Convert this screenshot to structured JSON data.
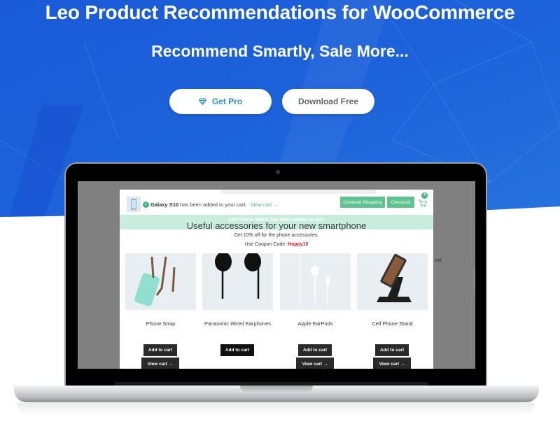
{
  "hero": {
    "title": "Leo Product Recommendations for WooCommerce",
    "subtitle": "Recommend Smartly, Sale More...",
    "buttons": {
      "get_pro": {
        "label": "Get Pro",
        "icon": "diamond-icon"
      },
      "download_free": {
        "label": "Download Free"
      }
    },
    "colors": {
      "background": "#1d63da",
      "pro_text": "#2c8fd8",
      "free_text": "#666666"
    }
  },
  "popup": {
    "notice": {
      "product": "Galaxy S10",
      "message": "has been added to your cart.",
      "view_cart": "View cart →"
    },
    "buttons": {
      "continue": "Continue Shopping",
      "checkout": "Checkout"
    },
    "cart_count": "4",
    "banner_message": "Cell Phone Stand has been added to cart.",
    "heading": "Useful accessories for your new smartphone",
    "description": "Get 10% off for the phone accessories.",
    "coupon_label": "Use Coupon Code:",
    "coupon_code": "Happy10",
    "products": [
      {
        "name": "Phone Strap",
        "add_label": "Add to cart",
        "view_label": "View cart →"
      },
      {
        "name": "Panasonic Wired Earphones",
        "add_label": "Add to cart",
        "view_label": ""
      },
      {
        "name": "Apple EarPods",
        "add_label": "Add to cart",
        "view_label": "View cart →"
      },
      {
        "name": "Cell Phone Stand",
        "add_label": "Add to cart",
        "view_label": "View cart →"
      }
    ],
    "background_text": "net,",
    "colors": {
      "accent_green": "#5ec38f",
      "banner": "#c8ecdd",
      "coupon": "#e02020"
    }
  }
}
